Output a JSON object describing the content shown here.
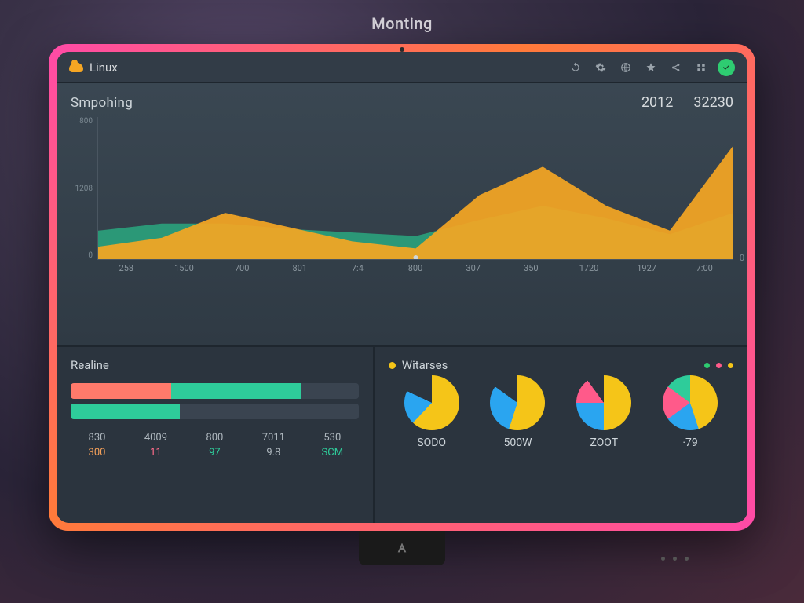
{
  "outer_title": "Monting",
  "topbar": {
    "brand": "Linux",
    "icons": [
      "refresh-icon",
      "settings-icon",
      "network-icon",
      "star-icon",
      "share-icon",
      "apps-icon",
      "power-icon"
    ]
  },
  "chart": {
    "title": "Smpohing",
    "stat_a": "2012",
    "stat_b": "32230",
    "y_ticks": [
      "800",
      "1208",
      "0"
    ],
    "x_ticks": [
      "258",
      "1500",
      "700",
      "801",
      "7:4",
      "800",
      "307",
      "350",
      "1720",
      "1927",
      "7:00"
    ],
    "right_axis_zero": "0"
  },
  "chart_data": {
    "type": "area",
    "x_index": [
      0,
      1,
      2,
      3,
      4,
      5,
      6,
      7,
      8,
      9,
      10
    ],
    "series": [
      {
        "name": "orange",
        "color": "#f5a623",
        "values": [
          70,
          120,
          260,
          180,
          100,
          60,
          360,
          520,
          300,
          160,
          640
        ]
      },
      {
        "name": "teal",
        "color": "#2aa87f",
        "values": [
          160,
          200,
          200,
          170,
          150,
          130,
          220,
          300,
          230,
          140,
          260
        ]
      }
    ],
    "ylim": [
      0,
      800
    ]
  },
  "realine": {
    "title": "Realine",
    "bars": [
      {
        "segments": [
          {
            "color": "#ff7a6b",
            "pct": 35
          },
          {
            "color": "#2ecc9a",
            "pct": 45
          },
          {
            "color": "#3a4450",
            "pct": 20
          }
        ]
      },
      {
        "segments": [
          {
            "color": "#2ecc9a",
            "pct": 38
          },
          {
            "color": "#3a4450",
            "pct": 62
          }
        ]
      }
    ],
    "row1": [
      "830",
      "4009",
      "800",
      "7011",
      "530"
    ],
    "row2": [
      "300",
      "11",
      "97",
      "9.8",
      "SCM"
    ]
  },
  "widgets": {
    "title": "Witarses",
    "legend_color": "#f5c518",
    "status_colors": [
      "#2ecc71",
      "#ff5a8a",
      "#f5c518"
    ],
    "pies": [
      {
        "label": "SODO",
        "sub": "",
        "slices": [
          {
            "c": "#f5c518",
            "p": 62
          },
          {
            "c": "#2aa5f0",
            "p": 20
          },
          {
            "c": "#2b343e",
            "p": 18
          }
        ]
      },
      {
        "label": "500W",
        "sub": "",
        "slices": [
          {
            "c": "#f5c518",
            "p": 55
          },
          {
            "c": "#2aa5f0",
            "p": 30
          },
          {
            "c": "#2b343e",
            "p": 15
          }
        ]
      },
      {
        "label": "ZOOT",
        "sub": "",
        "slices": [
          {
            "c": "#f5c518",
            "p": 50
          },
          {
            "c": "#2aa5f0",
            "p": 25
          },
          {
            "c": "#ff5a8a",
            "p": 15
          },
          {
            "c": "#2b343e",
            "p": 10
          }
        ]
      },
      {
        "label": "·79",
        "sub": "",
        "slices": [
          {
            "c": "#f5c518",
            "p": 45
          },
          {
            "c": "#2aa5f0",
            "p": 20
          },
          {
            "c": "#ff5a8a",
            "p": 20
          },
          {
            "c": "#2ecc9a",
            "p": 15
          }
        ]
      }
    ]
  }
}
